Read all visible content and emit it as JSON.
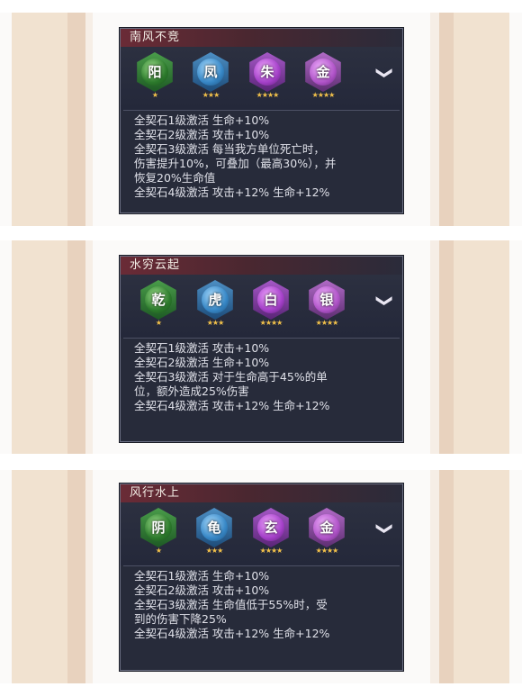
{
  "sets": [
    {
      "title": "南风不竞",
      "stones": [
        {
          "char": "阳",
          "stars": "★",
          "color": "#3f9a44"
        },
        {
          "char": "凤",
          "stars": "★★★",
          "color": "#3d86c0"
        },
        {
          "char": "朱",
          "stars": "★★★★",
          "color": "#a44ac4"
        },
        {
          "char": "金",
          "stars": "★★★★",
          "color": "#ae5ec6"
        }
      ],
      "lines": [
        "全契石1级激活 生命+10%",
        "全契石2级激活 攻击+10%",
        "全契石3级激活 每当我方单位死亡时，",
        "伤害提升10%，可叠加（最高30%），并",
        "恢复20%生命值",
        "全契石4级激活 攻击+12% 生命+12%"
      ]
    },
    {
      "title": "水穷云起",
      "stones": [
        {
          "char": "乾",
          "stars": "★",
          "color": "#3f9a44"
        },
        {
          "char": "虎",
          "stars": "★★★",
          "color": "#3d86c0"
        },
        {
          "char": "白",
          "stars": "★★★★",
          "color": "#a44ac4"
        },
        {
          "char": "银",
          "stars": "★★★★",
          "color": "#ae5ec6"
        }
      ],
      "lines": [
        "全契石1级激活 攻击+10%",
        "全契石2级激活 生命+10%",
        "全契石3级激活 对于生命高于45%的单",
        "位，额外造成25%伤害",
        "全契石4级激活 攻击+12% 生命+12%"
      ]
    },
    {
      "title": "风行水上",
      "stones": [
        {
          "char": "阴",
          "stars": "★",
          "color": "#3f9a44"
        },
        {
          "char": "龟",
          "stars": "★★★",
          "color": "#3d86c0"
        },
        {
          "char": "玄",
          "stars": "★★★★",
          "color": "#a44ac4"
        },
        {
          "char": "金",
          "stars": "★★★★",
          "color": "#ae5ec6"
        }
      ],
      "lines": [
        "全契石1级激活 生命+10%",
        "全契石2级激活 攻击+10%",
        "全契石3级激活 生命值低于55%时，受",
        "到的伤害下降25%",
        "全契石4级激活 攻击+12% 生命+12%"
      ]
    }
  ],
  "expand_icon": "chevron-down-icon"
}
